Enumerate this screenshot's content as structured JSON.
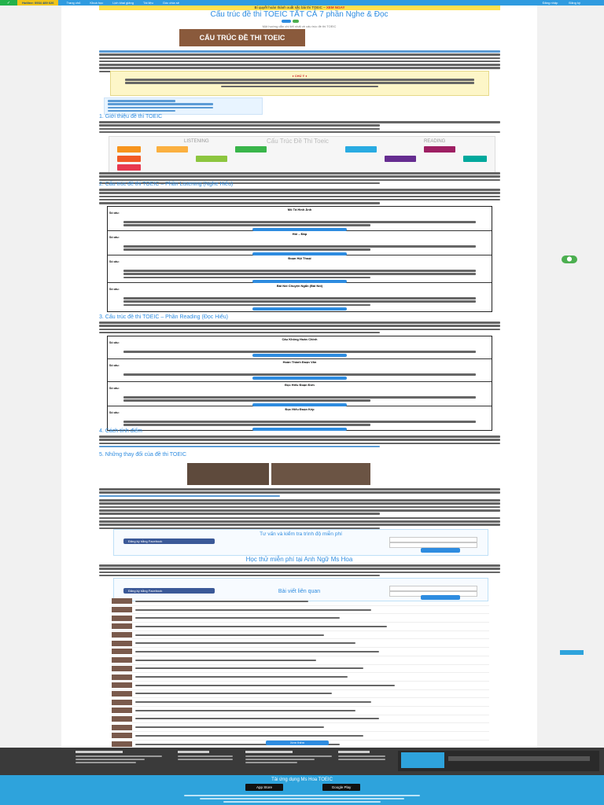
{
  "nav": {
    "logo": "✓",
    "hotline": "Hotline: 0934 489 626",
    "menu": [
      "Trang chủ",
      "Khoá học",
      "Lịch khai giảng",
      "Tài liệu",
      "Góc chia sẻ"
    ],
    "right": [
      "Đăng nhập",
      "Đăng ký"
    ]
  },
  "promo": {
    "text": "Bí quyết hoàn thành xuất sắc bài thi TOEIC –",
    "highlight": "XEM NGAY"
  },
  "article": {
    "title": "Cấu trúc đề thi TOEIC TẤT CẢ 7 phần Nghe & Đọc",
    "byline": "Một hướng dẫn chi tiết nhất về cấu trúc đề thi TOEIC",
    "hero_text": "CẤU TRÚC ĐỀ THI TOEIC",
    "note_heading": "♦ CHÚ Ý ♦",
    "h1": "1. Giới thiệu đề thi TOEIC",
    "h2": "2. Cấu trúc đề thi TOEIC – Phần Listening (Nghe Hiểu)",
    "h3": "3. Cấu trúc đề thi TOEIC – Phần Reading (Đọc Hiểu)",
    "h4": "4. Cách tính điểm",
    "h5": "5. Những thay đổi của đề thi TOEIC",
    "infographic_left": "LISTENING",
    "infographic_right": "READING",
    "infographic_title": "Cấu Trúc Đề Thi Toeic"
  },
  "listening_table": [
    {
      "head": "Mô Tả Hình Ảnh",
      "label": "Số câu:"
    },
    {
      "head": "Hỏi – Đáp",
      "label": "Số câu:"
    },
    {
      "head": "Đoạn Hội Thoại",
      "label": "Số câu:"
    },
    {
      "head": "Bài Nói Chuyện Ngắn (Bài Nói)",
      "label": "Số câu:"
    }
  ],
  "reading_table": [
    {
      "head": "Câu Không Hoàn Chỉnh",
      "label": "Số câu:"
    },
    {
      "head": "Hoàn Thành Đoạn Văn",
      "label": "Số câu:"
    },
    {
      "head": "Đọc Hiểu Đoạn Đơn",
      "label": "Số câu:"
    },
    {
      "head": "Đọc Hiểu Đoạn Kép",
      "label": "Số câu:"
    }
  ],
  "form1": {
    "title": "Tư vấn và kiểm tra trình độ miễn phí",
    "fb_label": "Đăng ký bằng Facebook",
    "submit": "Đăng ký"
  },
  "form2": {
    "title": "Học thử miễn phí tại Anh Ngữ Ms Hoa",
    "fb_label": "Đăng ký bằng Facebook",
    "submit": "Đăng ký"
  },
  "related": {
    "title": "Bài viết liên quan",
    "more": "Xem thêm"
  },
  "footer": {
    "app_title": "Tải ứng dụng Ms Hoa TOEIC",
    "app_store": "App Store",
    "google_play": "Google Play"
  },
  "side": {
    "round_label": "⬤"
  }
}
